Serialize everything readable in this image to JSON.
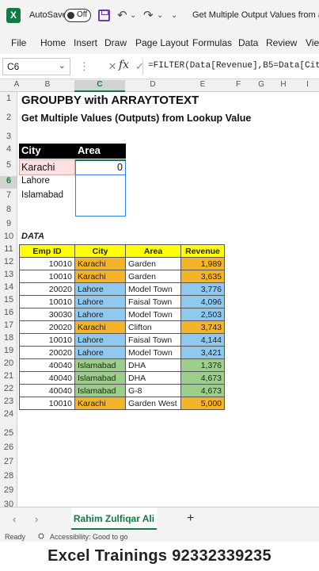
{
  "titlebar": {
    "logo": "X",
    "autosave_label": "AutoSave",
    "toggle_state": "Off",
    "undo_glyph": "↶",
    "redo_glyph": "↷",
    "more_glyph": "⌄",
    "doc_title": "Get Multiple Output Values from a Si"
  },
  "ribbon": {
    "tabs": [
      "File",
      "Home",
      "Insert",
      "Draw",
      "Page Layout",
      "Formulas",
      "Data",
      "Review",
      "View"
    ]
  },
  "formula_bar": {
    "cell_ref": "C6",
    "formula": "=FILTER(Data[Revenue],B5=Data[Cit",
    "fx": "fx",
    "icons": "⋮ ✕ ✓"
  },
  "grid": {
    "columns": [
      "A",
      "B",
      "C",
      "D",
      "E",
      "F",
      "G",
      "H",
      "I"
    ],
    "rows": [
      "1",
      "2",
      "3",
      "4",
      "5",
      "6",
      "7",
      "8",
      "9",
      "10",
      "11",
      "12",
      "13",
      "14",
      "15",
      "16",
      "17",
      "18",
      "19",
      "20",
      "21",
      "22",
      "23",
      "24",
      "25",
      "26",
      "27",
      "28",
      "29",
      "30"
    ],
    "selected_column": "C",
    "selected_row": "6"
  },
  "sheet": {
    "title": "GROUPBY with ARRAYTOTEXT",
    "subtitle": "Get Multiple Values (Outputs) from Lookup Value",
    "lookup": {
      "header_city": "City",
      "header_area": "Area",
      "cities": [
        "Karachi",
        "Lahore",
        "Islamabad"
      ],
      "result": "0"
    },
    "data_label": "DATA",
    "table": {
      "headers": [
        "Emp ID",
        "City",
        "Area",
        "Revenue"
      ],
      "rows": [
        {
          "emp": "10010",
          "city": "Karachi",
          "area": "Garden",
          "revenue": "1,989"
        },
        {
          "emp": "10010",
          "city": "Karachi",
          "area": "Garden",
          "revenue": "3,635"
        },
        {
          "emp": "20020",
          "city": "Lahore",
          "area": "Model Town",
          "revenue": "3,776"
        },
        {
          "emp": "10010",
          "city": "Lahore",
          "area": "Faisal Town",
          "revenue": "4,096"
        },
        {
          "emp": "30030",
          "city": "Lahore",
          "area": "Model Town",
          "revenue": "2,503"
        },
        {
          "emp": "20020",
          "city": "Karachi",
          "area": "Clifton",
          "revenue": "3,743"
        },
        {
          "emp": "10010",
          "city": "Lahore",
          "area": "Faisal Town",
          "revenue": "4,144"
        },
        {
          "emp": "20020",
          "city": "Lahore",
          "area": "Model Town",
          "revenue": "3,421"
        },
        {
          "emp": "40040",
          "city": "Islamabad",
          "area": "DHA",
          "revenue": "1,376"
        },
        {
          "emp": "40040",
          "city": "Islamabad",
          "area": "DHA",
          "revenue": "4,673"
        },
        {
          "emp": "40040",
          "city": "Islamabad",
          "area": "G-8",
          "revenue": "4,673"
        },
        {
          "emp": "10010",
          "city": "Karachi",
          "area": "Garden West",
          "revenue": "5,000"
        }
      ]
    }
  },
  "colors": {
    "karachi": "#f4b42a",
    "lahore": "#8fc9ee",
    "islamabad": "#9cd08a",
    "header": "#ffff00",
    "accent": "#107c41"
  },
  "sheet_tabs": {
    "prev": "‹",
    "next": "›",
    "active": "Rahim Zulfiqar Ali",
    "add": "+"
  },
  "status": {
    "ready": "Ready",
    "accessibility": "Accessibility: Good to go"
  },
  "banner": "Excel Trainings 92332339235"
}
